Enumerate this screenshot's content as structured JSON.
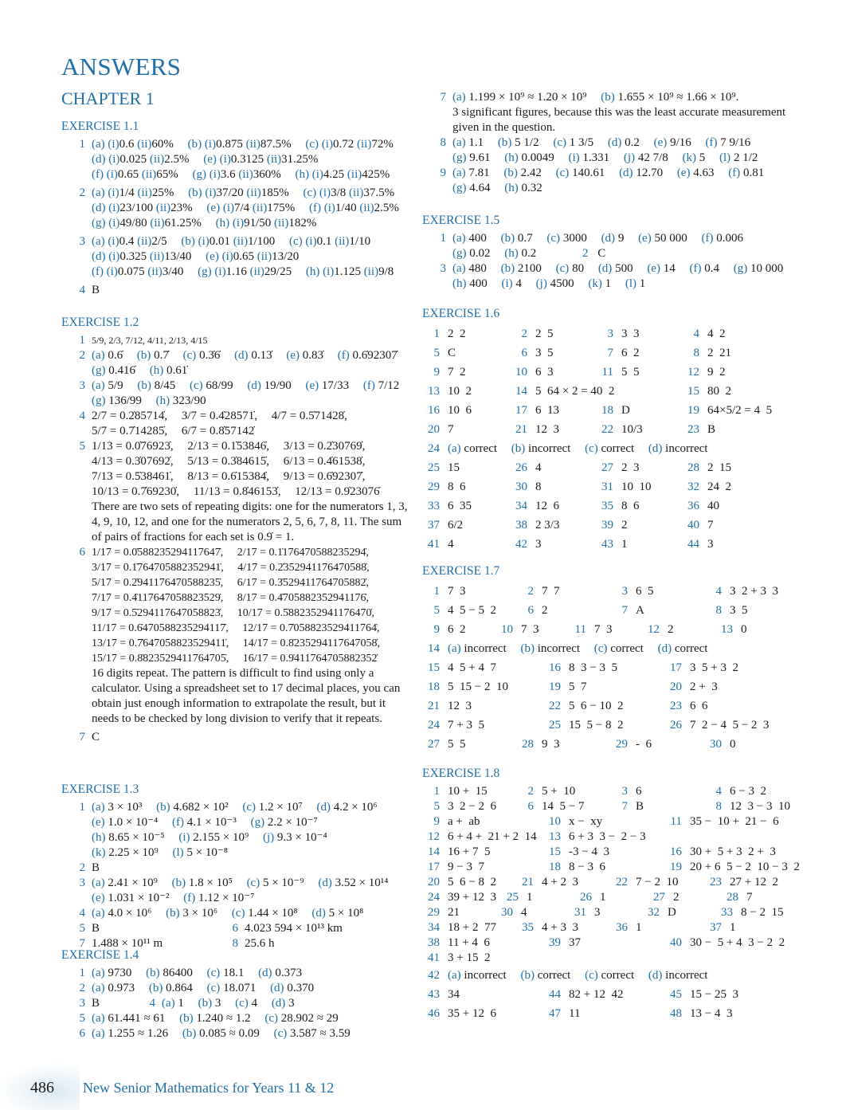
{
  "title": "ANSWERS",
  "chapter": "CHAPTER 1",
  "accent_color": "#1f6fa8",
  "footer": {
    "page_number": "486",
    "book_title": "New Senior Mathematics for Years 11 & 12"
  },
  "ex1_1": {
    "heading": "EXERCISE 1.1",
    "q1": [
      "(a) (i)0.6 (ii)60%",
      "(b) (i)0.875 (ii)87.5%",
      "(c) (i)0.72 (ii)72%",
      "(d) (i)0.025 (ii)2.5%",
      "(e) (i)0.3125 (ii)31.25%",
      "(f) (i)0.65 (ii)65%",
      "(g) (i)3.6 (ii)360%",
      "(h) (i)4.25 (ii)425%"
    ],
    "q2": [
      "(a) (i)1/4 (ii)25%",
      "(b) (i)37/20 (ii)185%",
      "(c) (i)3/8 (ii)37.5%",
      "(d) (i)23/100 (ii)23%",
      "(e) (i)7/4 (ii)175%",
      "(f) (i)1/40 (ii)2.5%",
      "(g) (i)49/80 (ii)61.25%",
      "(h) (i)91/50 (ii)182%"
    ],
    "q3": [
      "(a) (i)0.4 (ii)2/5",
      "(b) (i)0.01 (ii)1/100",
      "(c) (i)0.1 (ii)1/10",
      "(d) (i)0.325 (ii)13/40",
      "(e) (i)0.65 (ii)13/20",
      "(f) (i)0.075 (ii)3/40",
      "(g) (i)1.16 (ii)29/25",
      "(h) (i)1.125 (ii)9/8"
    ],
    "q4": "B"
  },
  "ex1_2": {
    "heading": "EXERCISE 1.2",
    "q1": "5/9, 2/3, 7/12, 4/11, 2/13, 4/15",
    "q2": [
      "(a) 0.6̇",
      "(b) 0.7̇",
      "(c) 0.3̇6̇",
      "(d) 0.13̇",
      "(e) 0.83̇",
      "(f) 0.6̇92307̇",
      "(g) 0.416̇",
      "(h) 0.61̇"
    ],
    "q3": [
      "(a) 5/9",
      "(b) 8/45",
      "(c) 68/99",
      "(d) 19/90",
      "(e) 17/33",
      "(f) 7/12",
      "(g) 136/99",
      "(h) 323/90"
    ],
    "q4": [
      "2/7 = 0.2̇85714̇,",
      "3/7 = 0.4̇28571̇,",
      "4/7 = 0.5̇71428̇,",
      "5/7 = 0.7̇14285̇,",
      "6/7 = 0.8̇57142̇"
    ],
    "q5": [
      "1/13 = 0.0̇76923̇,",
      "2/13 = 0.1̇53846̇,",
      "3/13 = 0.2̇30769̇,",
      "4/13 = 0.3̇07692̇,",
      "5/13 = 0.3̇84615̇,",
      "6/13 = 0.4̇61538̇,",
      "7/13 = 0.5̇38461̇,",
      "8/13 = 0.6̇15384̇,",
      "9/13 = 0.6̇92307̇,",
      "10/13 = 0.7̇69230̇,",
      "11/13 = 0.8̇46153̇,",
      "12/13 = 0.9̇23076̇"
    ],
    "q5_note": "There are two sets of repeating digits: one for the numerators 1, 3, 4, 9, 10, 12, and one for the numerators 2, 5, 6, 7, 8, 11. The sum of pairs of fractions for each set is 0.9̇ = 1.",
    "q6": [
      "1/17 = 0.0̇588235294117647̇,",
      "2/17 = 0.1̇176470588235294̇,",
      "3/17 = 0.1̇764705882352941̇,",
      "4/17 = 0.2̇352941176470588̇,",
      "5/17 = 0.2̇941176470588235̇,",
      "6/17 = 0.3̇529411764705882̇,",
      "7/17 = 0.4̇117647058823529̇,",
      "8/17 = 0.4̇705882352941176̇,",
      "9/17 = 0.5̇294117647058823̇,",
      "10/17 = 0.5̇882352941176470̇,",
      "11/17 = 0.6̇470588235294117̇,",
      "12/17 = 0.7̇058823529411764̇,",
      "13/17 = 0.7̇647058823529411̇,",
      "14/17 = 0.8̇235294117647058̇,",
      "15/17 = 0.8̇823529411764705̇,",
      "16/17 = 0.9̇411764705882352̇"
    ],
    "q6_note": "16 digits repeat. The pattern is difficult to find using only a calculator. Using a spreadsheet set to 17 decimal places, you can obtain just enough information to extrapolate the result, but it needs to be checked by long division to verify that it repeats.",
    "q7": "C"
  },
  "ex1_3": {
    "heading": "EXERCISE 1.3",
    "q1": [
      "(a) 3 × 10³",
      "(b) 4.682 × 10²",
      "(c) 1.2 × 10⁷",
      "(d) 4.2 × 10⁶",
      "(e) 1.0 × 10⁻⁴",
      "(f) 4.1 × 10⁻³",
      "(g) 2.2 × 10⁻⁷",
      "(h) 8.65 × 10⁻⁵",
      "(i) 2.155 × 10⁹",
      "(j) 9.3 × 10⁻⁴",
      "(k) 2.25 × 10⁹",
      "(l) 5 × 10⁻⁸"
    ],
    "q2": "B",
    "q3": [
      "(a) 2.41 × 10⁹",
      "(b) 1.8 × 10⁵",
      "(c) 5 × 10⁻⁹",
      "(d) 3.52 × 10¹⁴",
      "(e) 1.031 × 10⁻²",
      "(f) 1.12 × 10⁻⁷"
    ],
    "q4": [
      "(a) 4.0 × 10⁶",
      "(b) 3 × 10⁶",
      "(c) 1.44 × 10⁸",
      "(d) 5 × 10⁸"
    ],
    "q5": "B",
    "q6": "4.023 594 × 10¹³ km",
    "q7": "1.488 × 10¹¹ m",
    "q8": "25.6 h"
  },
  "ex1_4": {
    "heading": "EXERCISE 1.4",
    "q1": [
      "(a) 9730",
      "(b) 86400",
      "(c) 18.1",
      "(d) 0.373"
    ],
    "q2": [
      "(a) 0.973",
      "(b) 0.864",
      "(c) 18.071",
      "(d) 0.370"
    ],
    "q3": "B",
    "q4": [
      "(a) 1",
      "(b) 3",
      "(c) 4",
      "(d) 3"
    ],
    "q5": [
      "(a) 61.441 ≈ 61",
      "(b) 1.240 ≈ 1.2",
      "(c) 28.902 ≈ 29"
    ],
    "q6": [
      "(a) 1.255 ≈ 1.26",
      "(b) 0.085 ≈ 0.09",
      "(c) 3.587 ≈ 3.59"
    ],
    "q7": [
      "(a) 1.199 × 10⁹ ≈ 1.20 × 10⁹",
      "(b) 1.655 × 10⁹ ≈ 1.66 × 10⁹."
    ],
    "q7_note": "3 significant figures, because this was the least accurate measurement given in the question.",
    "q8": [
      "(a) 1.1",
      "(b) 5 1/2",
      "(c) 1 3/5",
      "(d) 0.2",
      "(e) 9/16",
      "(f) 7 9/16",
      "(g) 9.61",
      "(h) 0.0049",
      "(i) 1.331",
      "(j) 42 7/8",
      "(k) 5",
      "(l) 2 1/2"
    ],
    "q9": [
      "(a) 7.81",
      "(b) 2.42",
      "(c) 140.61",
      "(d) 12.70",
      "(e) 4.63",
      "(f) 0.81",
      "(g) 4.64",
      "(h) 0.32"
    ]
  },
  "ex1_5": {
    "heading": "EXERCISE 1.5",
    "q1": [
      "(a) 400",
      "(b) 0.7",
      "(c) 3000",
      "(d) 9",
      "(e) 50 000",
      "(f) 0.006",
      "(g) 0.02",
      "(h) 0.2"
    ],
    "q2": "C",
    "q3": [
      "(a) 480",
      "(b) 2100",
      "(c) 80",
      "(d) 500",
      "(e) 14",
      "(f) 0.4",
      "(g) 10 000",
      "(h) 400",
      "(i) 4",
      "(j) 4500",
      "(k) 1",
      "(l) 1"
    ]
  },
  "ex1_6": {
    "heading": "EXERCISE 1.6",
    "items": [
      [
        "1",
        "2  2"
      ],
      [
        "2",
        "2  5"
      ],
      [
        "3",
        "3  3"
      ],
      [
        "4",
        "4  2"
      ],
      [
        "5",
        "C"
      ],
      [
        "6",
        "3  5"
      ],
      [
        "7",
        "6  2"
      ],
      [
        "8",
        "2  21"
      ],
      [
        "9",
        "7  2"
      ],
      [
        "10",
        "6  3"
      ],
      [
        "11",
        "5  5"
      ],
      [
        "12",
        "9  2"
      ],
      [
        "13",
        "10  2"
      ],
      [
        "14",
        "5  64 × 2 = 40  2"
      ],
      [
        "",
        ""
      ],
      [
        "15",
        "80  2"
      ],
      [
        "16",
        "10  6"
      ],
      [
        "17",
        "6  13"
      ],
      [
        "18",
        "D"
      ],
      [
        "19",
        "64×5/2 = 4  5"
      ],
      [
        "20",
        "7"
      ],
      [
        "21",
        "12  3"
      ],
      [
        "22",
        "10/3"
      ],
      [
        "23",
        "B"
      ]
    ],
    "q24": [
      "(a) correct",
      "(b) incorrect",
      "(c) correct",
      "(d) incorrect"
    ],
    "items2": [
      [
        "25",
        "15"
      ],
      [
        "26",
        "4"
      ],
      [
        "27",
        "2  3"
      ],
      [
        "28",
        "2  15"
      ],
      [
        "29",
        "8  6"
      ],
      [
        "30",
        "8"
      ],
      [
        "31",
        "10  10"
      ],
      [
        "32",
        "24  2"
      ],
      [
        "33",
        "6  35"
      ],
      [
        "34",
        "12  6"
      ],
      [
        "35",
        "8  6"
      ],
      [
        "36",
        "40"
      ],
      [
        "37",
        "6/2"
      ],
      [
        "38",
        "2 3/3"
      ],
      [
        "39",
        "2"
      ],
      [
        "40",
        "7"
      ],
      [
        "41",
        "4"
      ],
      [
        "42",
        "3"
      ],
      [
        "43",
        "1"
      ],
      [
        "44",
        "3"
      ]
    ]
  },
  "ex1_7": {
    "heading": "EXERCISE 1.7",
    "rows": [
      [
        [
          "1",
          "7  3"
        ],
        [
          "2",
          "7  7"
        ],
        [
          "3",
          "6  5"
        ],
        [
          "4",
          "3  2 + 3  3"
        ]
      ],
      [
        [
          "5",
          "4  5 − 5  2"
        ],
        [
          "6",
          "2"
        ],
        [
          "7",
          "A"
        ],
        [
          "8",
          "3  5"
        ]
      ],
      [
        [
          "9",
          "6  2"
        ],
        [
          "10",
          "7  3"
        ],
        [
          "11",
          "7  3"
        ],
        [
          "12",
          "2"
        ],
        [
          "13",
          "0"
        ]
      ]
    ],
    "q14": [
      "(a) incorrect",
      "(b) incorrect",
      "(c) correct",
      "(d) correct"
    ],
    "rows2": [
      [
        [
          "15",
          "4  5 + 4  7"
        ],
        [
          "16",
          "8  3 − 3  5"
        ],
        [
          "17",
          "3  5 + 3  2"
        ]
      ],
      [
        [
          "18",
          "5  15 − 2  10"
        ],
        [
          "19",
          "5  7"
        ],
        [
          "20",
          "2 +  3"
        ]
      ],
      [
        [
          "21",
          "12  3"
        ],
        [
          "22",
          "5  6 − 10  2"
        ],
        [
          "23",
          "6  6"
        ]
      ],
      [
        [
          "24",
          "7 + 3  5"
        ],
        [
          "25",
          "15  5 − 8  2"
        ],
        [
          "26",
          "7  2 − 4  5 − 2  3"
        ]
      ],
      [
        [
          "27",
          "5  5"
        ],
        [
          "28",
          "9  3"
        ],
        [
          "29",
          "-  6"
        ],
        [
          "30",
          "0"
        ]
      ]
    ]
  },
  "ex1_8": {
    "heading": "EXERCISE 1.8",
    "rows": [
      [
        [
          "1",
          "10 +  15"
        ],
        [
          "2",
          "5 +  10"
        ],
        [
          "3",
          "6"
        ],
        [
          "4",
          "6 − 3  2"
        ]
      ],
      [
        [
          "5",
          "3  2 − 2  6"
        ],
        [
          "6",
          "14  5 − 7"
        ],
        [
          "7",
          "B"
        ],
        [
          "8",
          "12  3 − 3  10"
        ]
      ],
      [
        [
          "9",
          "a +  ab"
        ],
        [
          "10",
          "x −  xy"
        ],
        [
          "11",
          "35 −  10 +  21 −  6"
        ]
      ],
      [
        [
          "12",
          "6 + 4 +  21 + 2  14"
        ],
        [
          "13",
          "6 + 3  3 −  2 − 3"
        ]
      ],
      [
        [
          "14",
          "16 + 7  5"
        ],
        [
          "15",
          "-3 − 4  3"
        ],
        [
          "16",
          "30 +  5 + 3  2 +  3"
        ]
      ],
      [
        [
          "17",
          "9 − 3  7"
        ],
        [
          "18",
          "8 − 3  6"
        ],
        [
          "19",
          "20 + 6  5 − 2  10 − 3  2"
        ]
      ],
      [
        [
          "20",
          "5  6 − 8  2"
        ],
        [
          "21",
          "4 + 2  3"
        ],
        [
          "22",
          "7 − 2  10"
        ],
        [
          "23",
          "27 + 12  2"
        ]
      ],
      [
        [
          "24",
          "39 + 12  3"
        ],
        [
          "25",
          "1"
        ],
        [
          "26",
          "1"
        ],
        [
          "27",
          "2"
        ],
        [
          "28",
          "7"
        ]
      ],
      [
        [
          "29",
          "21"
        ],
        [
          "30",
          "4"
        ],
        [
          "31",
          "3"
        ],
        [
          "32",
          "D"
        ],
        [
          "33",
          "8 − 2  15"
        ]
      ],
      [
        [
          "34",
          "18 + 2  77"
        ],
        [
          "35",
          "4 + 3  3"
        ],
        [
          "36",
          "1"
        ],
        [
          "37",
          "1"
        ]
      ],
      [
        [
          "38",
          "11 + 4  6"
        ],
        [
          "39",
          "37"
        ],
        [
          "40",
          "30 −  5 + 4  3 − 2  2"
        ]
      ],
      [
        [
          "41",
          "3 + 15  2"
        ]
      ]
    ],
    "q42": [
      "(a) incorrect",
      "(b) correct",
      "(c) correct",
      "(d) incorrect"
    ],
    "rows2": [
      [
        [
          "43",
          "34"
        ],
        [
          "44",
          "82 + 12  42"
        ],
        [
          "45",
          "15 − 25  3"
        ]
      ],
      [
        [
          "46",
          "35 + 12  6"
        ],
        [
          "47",
          "11"
        ],
        [
          "48",
          "13 − 4  3"
        ]
      ]
    ]
  }
}
